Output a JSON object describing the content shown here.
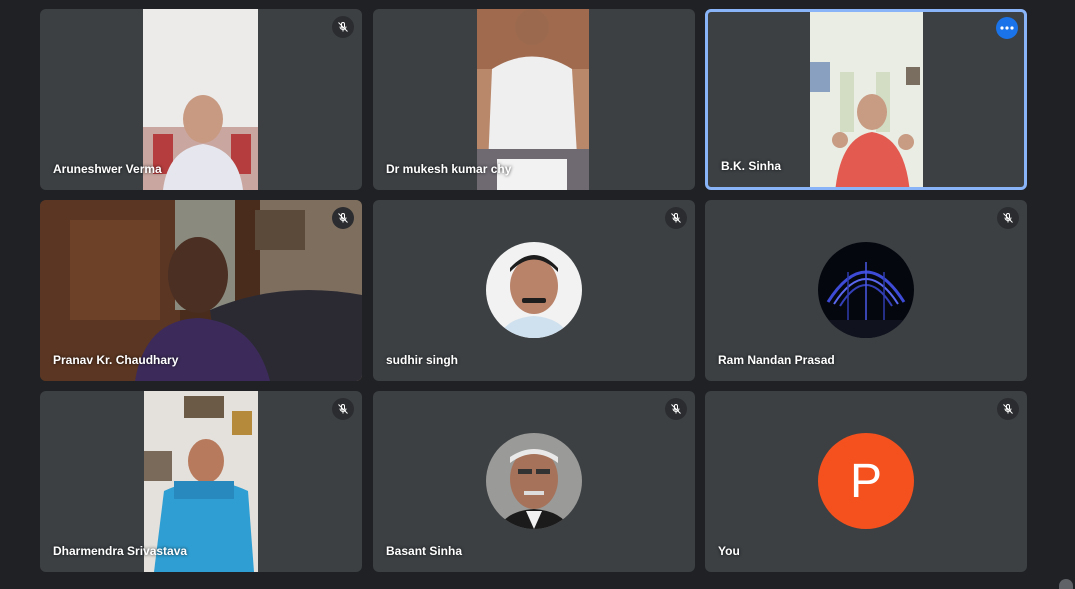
{
  "participants": [
    {
      "name": "Aruneshwer Verma",
      "muted": true
    },
    {
      "name": "Dr mukesh kumar chy",
      "muted": false
    },
    {
      "name": "B.K. Sinha",
      "muted": false,
      "active_speaker": true
    },
    {
      "name": "Pranav Kr. Chaudhary",
      "muted": true
    },
    {
      "name": "sudhir singh",
      "muted": true
    },
    {
      "name": "Ram Nandan Prasad",
      "muted": true
    },
    {
      "name": "Dharmendra Srivastava",
      "muted": true
    },
    {
      "name": "Basant Sinha",
      "muted": true
    },
    {
      "name": "You",
      "muted": true,
      "avatar_letter": "P"
    }
  ],
  "colors": {
    "background": "#202124",
    "tile": "#3c4043",
    "active_border": "#8ab4f8",
    "more_button": "#1a73e8",
    "you_avatar": "#f4511e"
  },
  "icons": {
    "mute": "mic-off-icon",
    "more": "more-horiz-icon"
  }
}
